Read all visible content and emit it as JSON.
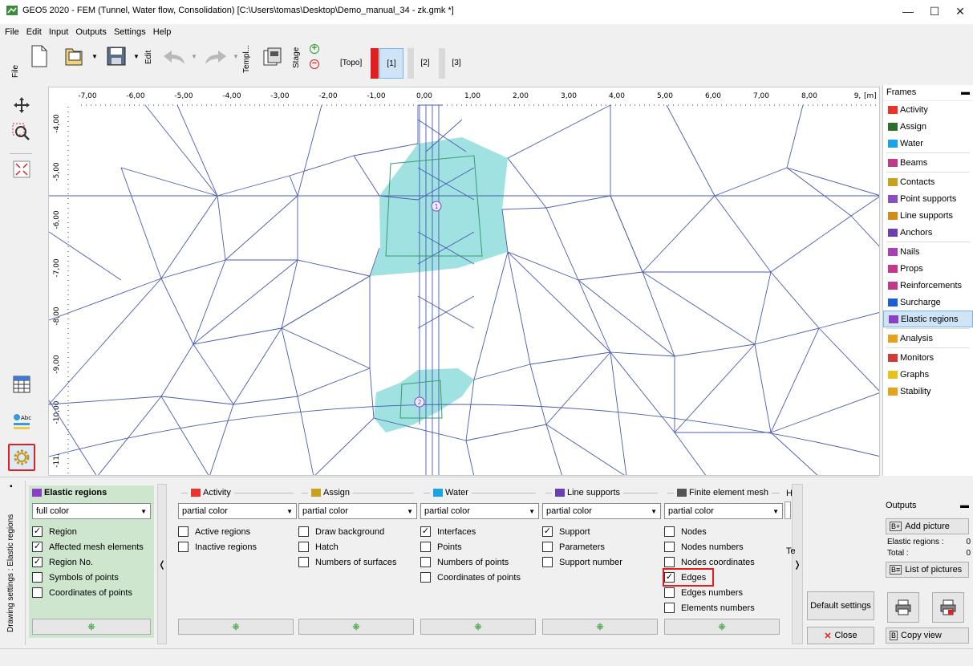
{
  "window": {
    "title": "GEO5 2020 - FEM (Tunnel, Water flow, Consolidation) [C:\\Users\\tomas\\Desktop\\Demo_manual_34 - zk.gmk *]",
    "minimize": "—",
    "maximize": "☐",
    "close": "✕"
  },
  "menu": [
    "File",
    "Edit",
    "Input",
    "Outputs",
    "Settings",
    "Help"
  ],
  "toolbar": {
    "file_label": "File",
    "edit_label": "Edit",
    "templates_label": "Templ...",
    "stage_label": "Stage",
    "stages": [
      "[Topo]",
      "[1]",
      "[2]",
      "[3]"
    ],
    "active_stage": "[1]"
  },
  "ruler": {
    "x_ticks": [
      "-7,00",
      "-6,00",
      "-5,00",
      "-4,00",
      "-3,00",
      "-2,00",
      "-1,00",
      "0,00",
      "1,00",
      "2,00",
      "3,00",
      "4,00",
      "5,00",
      "6,00",
      "7,00",
      "8,00",
      "9,"
    ],
    "x_unit": "[m]",
    "y_ticks": [
      "-4,00",
      "-5,00",
      "-6,00",
      "-7,00",
      "-8,00",
      "-9,00",
      "-10,00",
      "-11,"
    ]
  },
  "regions": {
    "labels": [
      "1",
      "2"
    ]
  },
  "frames": {
    "title": "Frames",
    "items": [
      {
        "label": "Activity",
        "icon": "activity-icon",
        "color": "#e8342b"
      },
      {
        "label": "Assign",
        "icon": "assign-icon",
        "color": "#2c6e2c"
      },
      {
        "label": "Water",
        "icon": "water-icon",
        "color": "#1aa3e8"
      },
      {
        "label": "Beams",
        "icon": "beam-icon",
        "color": "#c0398a"
      },
      {
        "label": "Contacts",
        "icon": "contacts-icon",
        "color": "#c9a21d"
      },
      {
        "label": "Point supports",
        "icon": "point-support-icon",
        "color": "#8a4fc4"
      },
      {
        "label": "Line supports",
        "icon": "line-support-icon",
        "color": "#d38b1b"
      },
      {
        "label": "Anchors",
        "icon": "anchor-icon",
        "color": "#6b3fb3"
      },
      {
        "label": "Nails",
        "icon": "nail-icon",
        "color": "#a83fb3"
      },
      {
        "label": "Props",
        "icon": "prop-icon",
        "color": "#c0398a"
      },
      {
        "label": "Reinforcements",
        "icon": "reinforcement-icon",
        "color": "#c0398a"
      },
      {
        "label": "Surcharge",
        "icon": "surcharge-icon",
        "color": "#1a5fd4"
      },
      {
        "label": "Elastic regions",
        "icon": "elastic-regions-icon",
        "color": "#8a3fc4"
      },
      {
        "label": "Analysis",
        "icon": "analysis-icon",
        "color": "#e8a21a"
      },
      {
        "label": "Monitors",
        "icon": "monitor-icon",
        "color": "#d43a3a"
      },
      {
        "label": "Graphs",
        "icon": "graph-icon",
        "color": "#e8c21a"
      },
      {
        "label": "Stability",
        "icon": "stability-icon",
        "color": "#e8a21a"
      }
    ],
    "selected": "Elastic regions"
  },
  "drawing_settings": {
    "side_label": "Drawing settings : Elastic regions",
    "columns": [
      {
        "title": "Elastic regions",
        "mode": "full color",
        "items": [
          {
            "label": "Region",
            "checked": true
          },
          {
            "label": "Affected mesh elements",
            "checked": true
          },
          {
            "label": "Region No.",
            "checked": true
          },
          {
            "label": "Symbols of points",
            "checked": false
          },
          {
            "label": "Coordinates of points",
            "checked": false
          }
        ]
      },
      {
        "title": "Activity",
        "mode": "partial color",
        "items": [
          {
            "label": "Active regions",
            "checked": false
          },
          {
            "label": "Inactive regions",
            "checked": false
          }
        ]
      },
      {
        "title": "Assign",
        "mode": "partial color",
        "items": [
          {
            "label": "Draw background",
            "checked": false
          },
          {
            "label": "Hatch",
            "checked": false
          },
          {
            "label": "Numbers of surfaces",
            "checked": false
          }
        ]
      },
      {
        "title": "Water",
        "mode": "partial color",
        "items": [
          {
            "label": "Interfaces",
            "checked": true
          },
          {
            "label": "Points",
            "checked": false
          },
          {
            "label": "Numbers of points",
            "checked": false
          },
          {
            "label": "Coordinates of points",
            "checked": false
          }
        ]
      },
      {
        "title": "Line supports",
        "mode": "partial color",
        "items": [
          {
            "label": "Support",
            "checked": true
          },
          {
            "label": "Parameters",
            "checked": false
          },
          {
            "label": "Support number",
            "checked": false
          }
        ]
      },
      {
        "title": "Finite element mesh",
        "mode": "partial color",
        "items": [
          {
            "label": "Nodes",
            "checked": false
          },
          {
            "label": "Nodes numbers",
            "checked": false
          },
          {
            "label": "Nodes coordinates",
            "checked": false
          },
          {
            "label": "Edges",
            "checked": true
          },
          {
            "label": "Edges numbers",
            "checked": false
          },
          {
            "label": "Elements numbers",
            "checked": false
          }
        ]
      }
    ],
    "partial_col_letters": [
      "H",
      "Te"
    ],
    "default_settings": "Default settings",
    "close": "Close"
  },
  "outputs": {
    "title": "Outputs",
    "add_picture": "Add picture",
    "elastic_regions_label": "Elastic regions :",
    "elastic_regions_count": "0",
    "total_label": "Total :",
    "total_count": "0",
    "list_of_pictures": "List of pictures",
    "copy_view": "Copy view"
  }
}
